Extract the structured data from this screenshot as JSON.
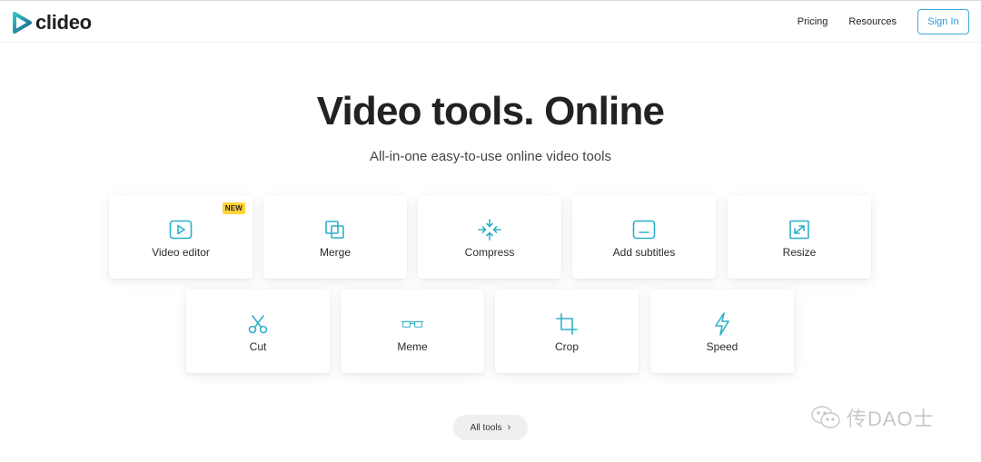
{
  "brand": {
    "name": "clideo",
    "accent": "#2fb8c6",
    "accent_dark": "#1f5f8b"
  },
  "nav": {
    "links": [
      "Pricing",
      "Resources"
    ],
    "signin_label": "Sign In"
  },
  "hero": {
    "title": "Video tools. Online",
    "subtitle": "All-in-one easy-to-use online video tools"
  },
  "tools": [
    {
      "label": "Video editor",
      "icon": "play-box-icon",
      "badge": "NEW"
    },
    {
      "label": "Merge",
      "icon": "merge-squares-icon"
    },
    {
      "label": "Compress",
      "icon": "compress-arrows-icon"
    },
    {
      "label": "Add subtitles",
      "icon": "subtitles-icon"
    },
    {
      "label": "Resize",
      "icon": "resize-icon"
    },
    {
      "label": "Cut",
      "icon": "scissors-icon"
    },
    {
      "label": "Meme",
      "icon": "glasses-icon"
    },
    {
      "label": "Crop",
      "icon": "crop-icon"
    },
    {
      "label": "Speed",
      "icon": "lightning-icon"
    }
  ],
  "all_tools_label": "All tools",
  "watermark": "传DAO士"
}
